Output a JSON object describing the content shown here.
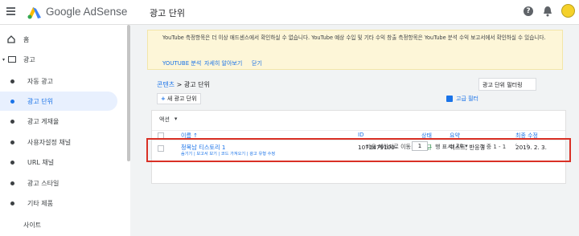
{
  "app": {
    "brand": "Google AdSense",
    "page_title": "광고 단위"
  },
  "sidebar": {
    "items": [
      {
        "label": "홈"
      },
      {
        "label": "광고"
      },
      {
        "label": "자동 광고"
      },
      {
        "label": "광고 단위"
      },
      {
        "label": "광고 게재율"
      },
      {
        "label": "사용자설정 채널"
      },
      {
        "label": "URL 채널"
      },
      {
        "label": "광고 스타일"
      },
      {
        "label": "기타 제품"
      },
      {
        "label": "사이트"
      }
    ]
  },
  "notice": {
    "text": "YouTube 측정항목은 더 이상 애드센스에서 확인하실 수 없습니다. YouTube 예상 수입 및 기타 수익 창출 측정항목은 YouTube 분석 수익 보고서에서 확인하실 수 있습니다.",
    "links": [
      "YOUTUBE 분석",
      "자세히 알아보기",
      "닫기"
    ]
  },
  "breadcrumb": {
    "parent": "콘텐츠",
    "sep": " > ",
    "current": "광고 단위"
  },
  "filter": {
    "placeholder": "광고 단위 필터링"
  },
  "toolbar": {
    "new_label": "새 광고 단위",
    "adv_filter": "고급 필터",
    "action_label": "액션",
    "action_caret": "▾"
  },
  "table": {
    "headers": {
      "name": "이름",
      "sort": "↑",
      "id": "ID",
      "status": "상태",
      "summary": "요약",
      "modified": "최종 수정"
    },
    "rows": [
      {
        "name": "청목남 티스토리 1",
        "id": "1072479100",
        "status": "신규",
        "summary": "텍스트, 반응형",
        "modified": "2019. 2. 3.",
        "actions": "숨기기 | 보고서 보기 | 코드 가져오기 | 광고 유형 수정"
      }
    ]
  },
  "pagination": {
    "go_label": "다음 페이지로 이동:",
    "page": "1",
    "rows_label": "행 표시:",
    "rows_value": "20",
    "rows_caret": "▾",
    "range": "1 중 1 - 1",
    "prev": "‹",
    "next": "›"
  },
  "colors": {
    "accent": "#1a73e8",
    "notice_bg": "#fdf6d8",
    "highlight": "#d93025",
    "status_new": "#188038"
  }
}
